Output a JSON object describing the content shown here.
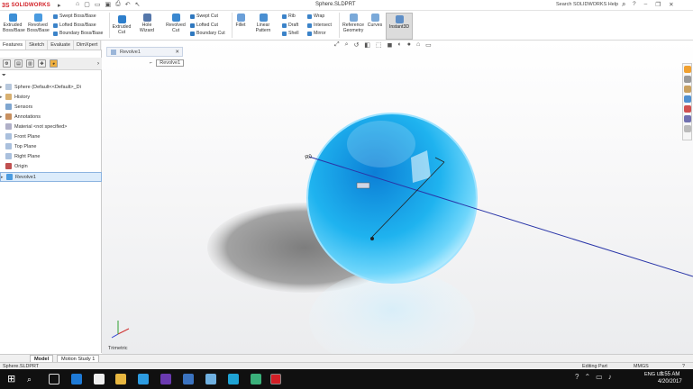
{
  "window": {
    "app_name": "SOLIDWORKS",
    "document_title": "Sphere.SLDPRT",
    "search_help": "Search SOLIDWORKS Help",
    "colors": {
      "brand": "#d21f26",
      "selection": "#dcecfb",
      "sphere": "#1fb3ef",
      "taskbar": "#101010"
    }
  },
  "ribbon": {
    "extruded_boss": "Extruded Boss/Base",
    "revolved_boss": "Revolved Boss/Base",
    "swept_boss": "Swept Boss/Base",
    "lofted_boss": "Lofted Boss/Base",
    "boundary_boss": "Boundary Boss/Base",
    "extruded_cut": "Extruded Cut",
    "hole_wizard": "Hole Wizard",
    "revolved_cut": "Revolved Cut",
    "swept_cut": "Swept Cut",
    "lofted_cut": "Lofted Cut",
    "boundary_cut": "Boundary Cut",
    "fillet": "Fillet",
    "linear_pattern": "Linear Pattern",
    "rib": "Rib",
    "draft": "Draft",
    "shell": "Shell",
    "wrap": "Wrap",
    "intersect": "Intersect",
    "mirror": "Mirror",
    "reference_geometry": "Reference Geometry",
    "curves": "Curves",
    "instant3d": "Instant3D"
  },
  "command_tabs": [
    "Features",
    "Sketch",
    "Evaluate",
    "DimXpert"
  ],
  "feature_tree": {
    "root": "Sphere (Default<<Default>_Di",
    "items": [
      "History",
      "Sensors",
      "Annotations",
      "Material <not specified>",
      "Front Plane",
      "Top Plane",
      "Right Plane",
      "Origin",
      "Revolve1"
    ],
    "selected_index": 8
  },
  "bottom_tabs": [
    "Model",
    "Motion Study 1"
  ],
  "viewport": {
    "doc_tab_label": "Revolve1",
    "popup_label": "Revolve1",
    "dimension_label": "R0",
    "view_name": "Trimetric"
  },
  "status": {
    "left": "Sphere.SLDPRT",
    "mid": "Editing Part",
    "units": "MMGS",
    "question": "?"
  },
  "taskbar": {
    "lang": "ENG US",
    "time": "2:55 AM",
    "date": "4/20/2017"
  }
}
